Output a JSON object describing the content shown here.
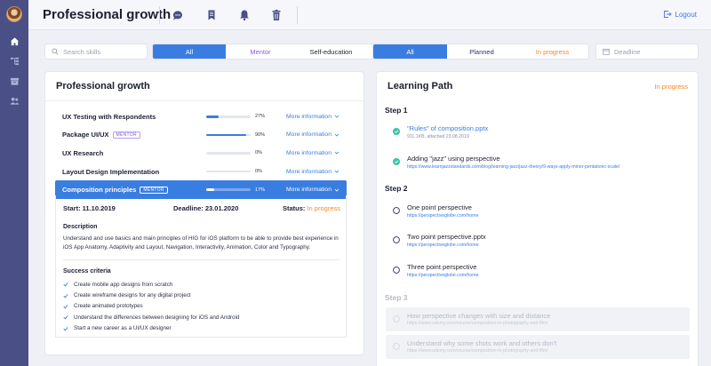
{
  "colors": {
    "accent": "#3a7de0",
    "sidebar": "#4a4f86",
    "mentor": "#7a58d8",
    "in_progress": "#f08a2c",
    "done": "#3cc3a7"
  },
  "header": {
    "title": "Professional growth",
    "logout_label": "Logout",
    "icons": [
      "chat-icon",
      "bookmark-icon",
      "bell-icon",
      "trash-icon"
    ]
  },
  "sidebar": {
    "icons": [
      "home-icon",
      "tree-icon",
      "archive-icon",
      "users-icon"
    ]
  },
  "filters": {
    "search_placeholder": "Search skills",
    "type_tabs": [
      {
        "label": "All",
        "active": true
      },
      {
        "label": "Mentor",
        "active": false
      },
      {
        "label": "Self-education",
        "active": false
      }
    ],
    "status_tabs": [
      {
        "label": "All",
        "active": true
      },
      {
        "label": "Planned",
        "active": false
      },
      {
        "label": "In progress",
        "active": false
      }
    ],
    "deadline_placeholder": "Deadline"
  },
  "growth": {
    "title": "Professional growth",
    "more_label": "More information",
    "skills": [
      {
        "name": "UX Testing with Respondents",
        "mentor": false,
        "progress": 27,
        "progress_text": "27%"
      },
      {
        "name": "Package UI/UX",
        "mentor": true,
        "progress": 90,
        "progress_text": "90%"
      },
      {
        "name": "UX Research",
        "mentor": false,
        "progress": 0,
        "progress_text": "0%"
      },
      {
        "name": "Layout Design Implementation",
        "mentor": false,
        "progress": 0,
        "progress_text": "0%"
      },
      {
        "name": "Composition principles",
        "mentor": true,
        "progress": 17,
        "progress_text": "17%",
        "selected": true
      }
    ],
    "mentor_badge": "MENTOR",
    "detail": {
      "start": "Start: 11.10.2019",
      "deadline": "Deadline: 23.01.2020",
      "status_label": "Status:",
      "status_value": "In progress",
      "description_title": "Description",
      "description": "Understand and use basics and main principles of HIG for iOS platform to be able to provide best experience in iOS App Anatomy, Adaptivity and Layout, Navigation, Interactivity, Animation, Color and Typography.",
      "criteria_title": "Success criteria",
      "criteria": [
        "Create mobile app designs from scratch",
        "Create wireframe designs for any digital project",
        "Create animated prototypes",
        "Understand the differences between designing for iOS and Android",
        "Start a new career as a UI/UX designer"
      ]
    }
  },
  "learning": {
    "title": "Learning Path",
    "status": "In progress",
    "steps": [
      {
        "label": "Step 1",
        "items": [
          {
            "title": "\"Rules\" of composition.pptx",
            "sub": "911.1KB, attached 23.08.2019",
            "done": true,
            "file": true
          },
          {
            "title": "Adding \"jazz\" using perspective",
            "sub": "https://www.learnjazzstandards.com/blog/learning-jazz/jazz-theory/9-ways-apply-minor-pentatonic-scale/",
            "done": true
          }
        ]
      },
      {
        "label": "Step 2",
        "items": [
          {
            "title": "One point perspective",
            "sub": "https://perspectiveglobe.com/home",
            "done": false
          },
          {
            "title": "Two point perspective.pptx",
            "sub": "https://perspectiveglobe.com/home",
            "done": false
          },
          {
            "title": "Three point perspective",
            "sub": "https://perspectiveglobe.com/home",
            "done": false
          }
        ]
      },
      {
        "label": "Step 3",
        "disabled": true,
        "items": [
          {
            "title": "How perspective changes with size and distance",
            "sub": "https://www.udemy.com/course/composition-in-photography-and-film/"
          },
          {
            "title": "Understand why some shots work and others don't",
            "sub": "https://www.udemy.com/course/composition-in-photography-and-film/"
          }
        ]
      }
    ]
  }
}
